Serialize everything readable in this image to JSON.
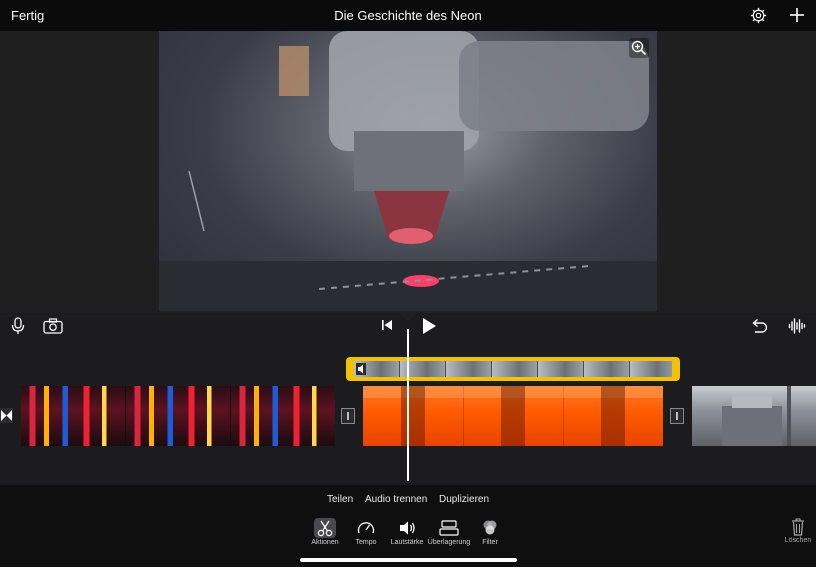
{
  "topbar": {
    "done_label": "Fertig",
    "title": "Die Geschichte des Neon",
    "settings_icon": "gear-icon",
    "add_icon": "plus-icon"
  },
  "viewer": {
    "zoom_icon": "magnify-icon"
  },
  "timeline_toolbar": {
    "mic_icon": "microphone-icon",
    "camera_icon": "camera-icon",
    "skip_start_icon": "skip-to-start-icon",
    "play_icon": "play-icon",
    "undo_icon": "undo-icon",
    "waveform_icon": "audio-waveform-icon"
  },
  "actions": {
    "split_label": "Teilen",
    "detach_audio_label": "Audio trennen",
    "duplicate_label": "Duplizieren"
  },
  "tools": [
    {
      "label": "Aktionen",
      "icon": "scissors-icon"
    },
    {
      "label": "Tempo",
      "icon": "speedometer-icon"
    },
    {
      "label": "Lautstärke",
      "icon": "speaker-icon"
    },
    {
      "label": "Überlagerung",
      "icon": "overlay-icon"
    },
    {
      "label": "Filter",
      "icon": "filter-circles-icon"
    }
  ],
  "delete": {
    "label": "Löschen",
    "icon": "trash-icon"
  },
  "colors": {
    "selection": "#f2c200",
    "background": "#000000",
    "orange_clip": "#ff5a00"
  }
}
